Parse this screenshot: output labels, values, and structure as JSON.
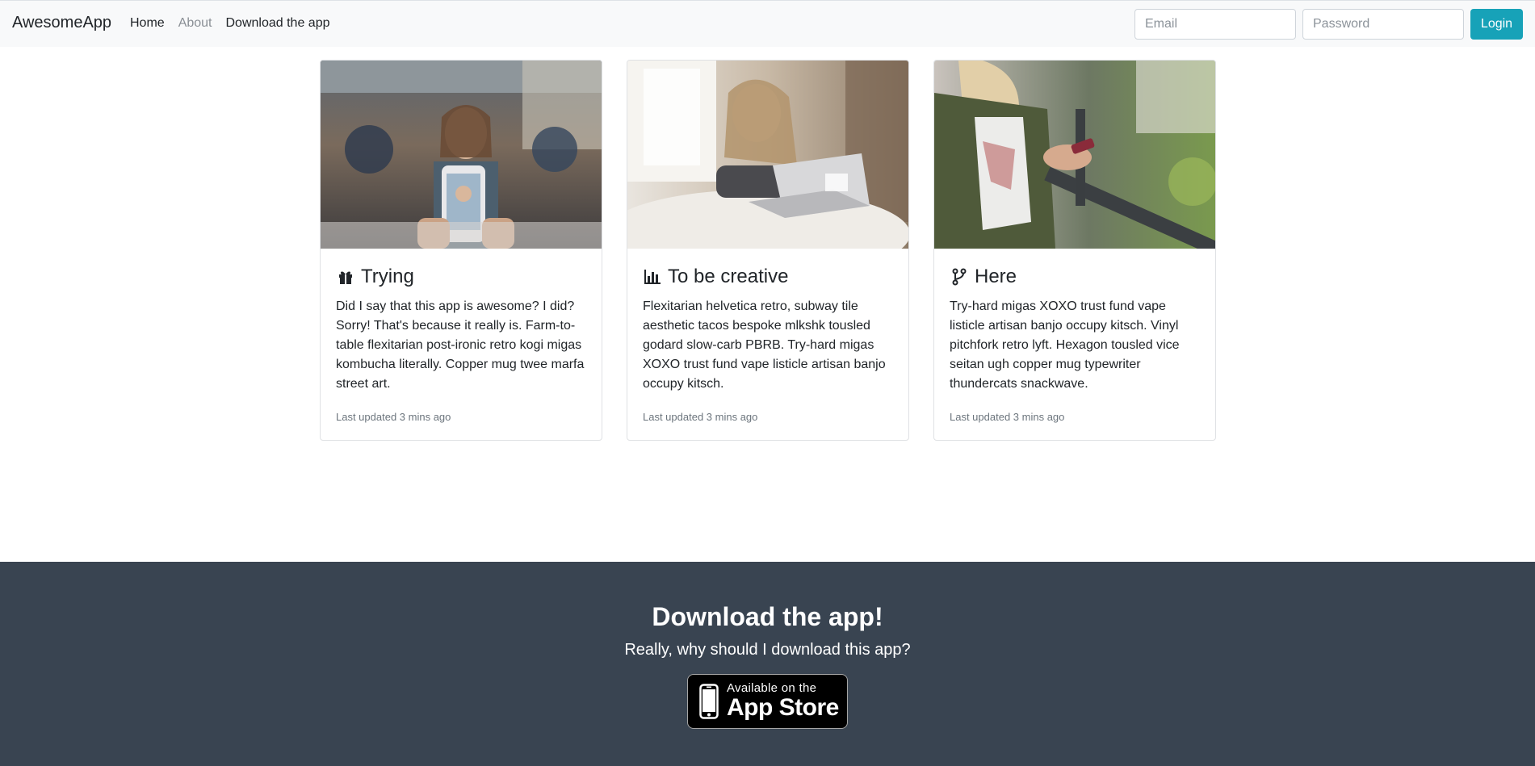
{
  "navbar": {
    "brand": "AwesomeApp",
    "links": [
      "Home",
      "About",
      "Download the app"
    ],
    "email_placeholder": "Email",
    "password_placeholder": "Password",
    "login_label": "Login"
  },
  "cards": [
    {
      "icon": "gift-icon",
      "title": "Trying",
      "text": "Did I say that this app is awesome? I did? Sorry! That's because it really is. Farm-to-table flexitarian post-ironic retro kogi migas kombucha literally. Copper mug twee marfa street art.",
      "meta": "Last updated 3 mins ago"
    },
    {
      "icon": "bar-chart-icon",
      "title": "To be creative",
      "text": "Flexitarian helvetica retro, subway tile aesthetic tacos bespoke mlkshk tousled godard slow-carb PBRB. Try-hard migas XOXO trust fund vape listicle artisan banjo occupy kitsch.",
      "meta": "Last updated 3 mins ago"
    },
    {
      "icon": "code-branch-icon",
      "title": "Here",
      "text": "Try-hard migas XOXO trust fund vape listicle artisan banjo occupy kitsch. Vinyl pitchfork retro lyft. Hexagon tousled vice seitan ugh copper mug typewriter thundercats snackwave.",
      "meta": "Last updated 3 mins ago"
    }
  ],
  "footer": {
    "title": "Download the app!",
    "subtitle": "Really, why should I download this app?",
    "badge_small": "Available on the",
    "badge_big": "App Store"
  },
  "colors": {
    "accent": "#17a2b8",
    "footer_bg": "#394451",
    "navbar_bg": "#f8f9fa"
  }
}
